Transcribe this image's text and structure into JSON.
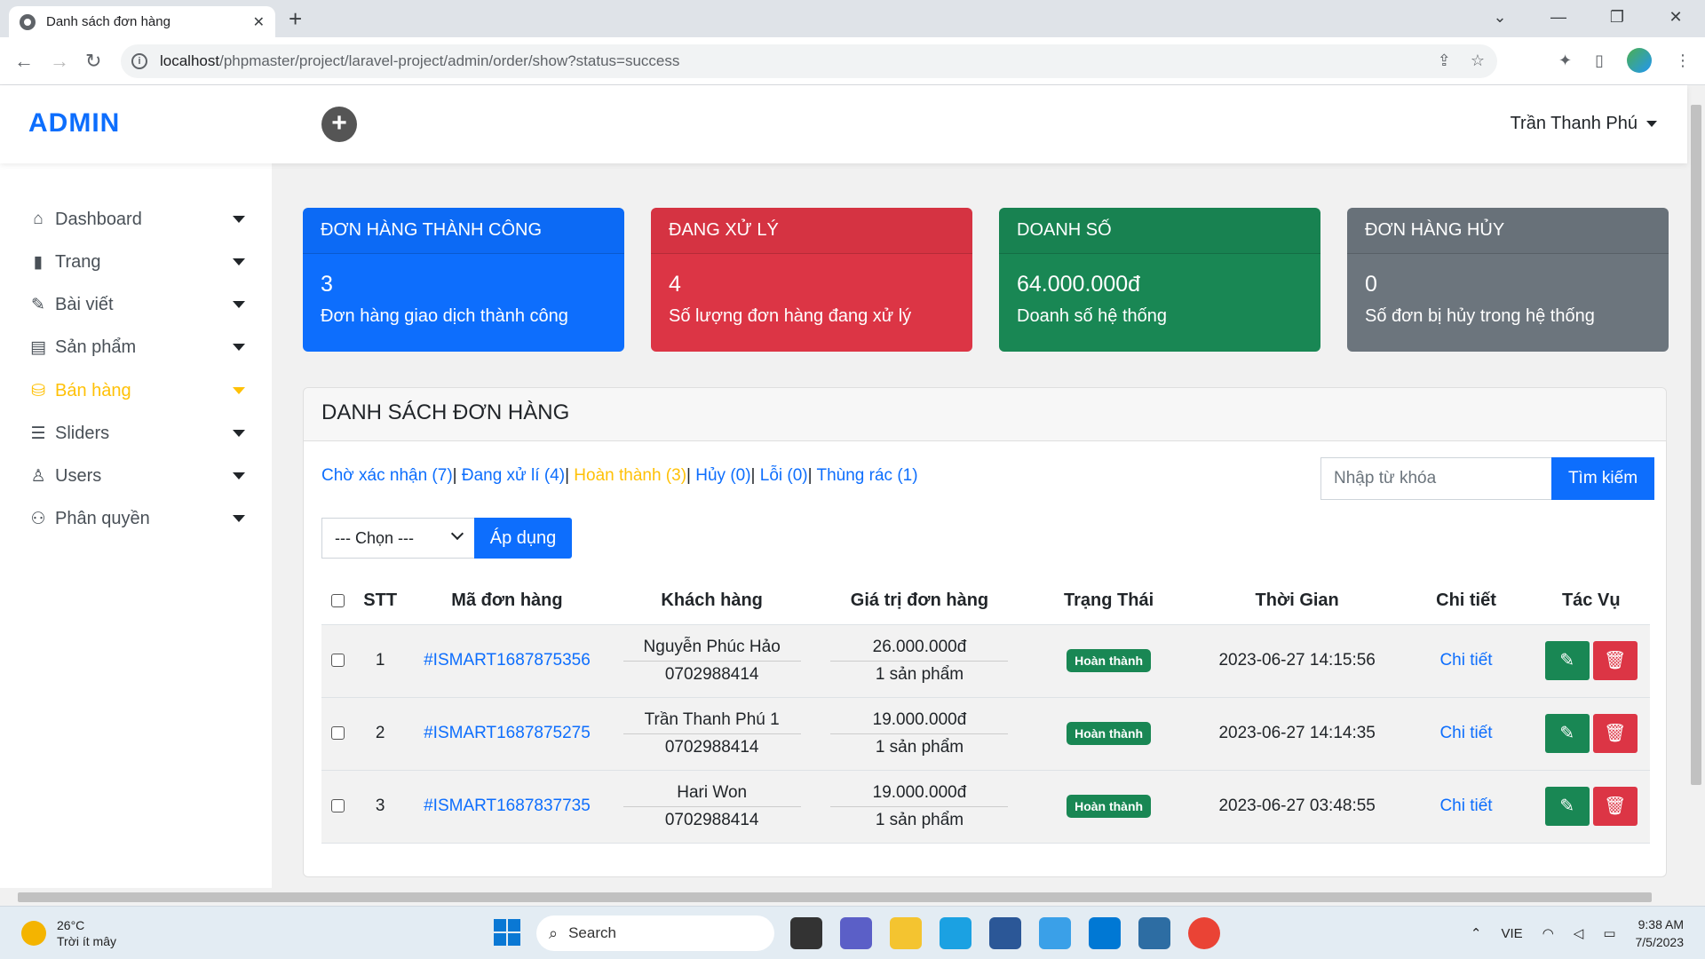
{
  "browser": {
    "tab_title": "Danh sách đơn hàng",
    "url_host": "localhost",
    "url_path": "/phpmaster/project/laravel-project/admin/order/show?status=success"
  },
  "header": {
    "brand": "ADMIN",
    "user_name": "Trần Thanh Phú"
  },
  "sidebar": {
    "items": [
      {
        "label": "Dashboard",
        "icon": "home-icon"
      },
      {
        "label": "Trang",
        "icon": "file-icon"
      },
      {
        "label": "Bài viết",
        "icon": "edit-icon"
      },
      {
        "label": "Sản phẩm",
        "icon": "store-icon"
      },
      {
        "label": "Bán hàng",
        "icon": "basket-icon",
        "active": true
      },
      {
        "label": "Sliders",
        "icon": "sliders-icon"
      },
      {
        "label": "Users",
        "icon": "user-icon"
      },
      {
        "label": "Phân quyền",
        "icon": "users-icon"
      }
    ]
  },
  "stats": [
    {
      "title": "ĐƠN HÀNG THÀNH CÔNG",
      "value": "3",
      "desc": "Đơn hàng giao dịch thành công",
      "color": "#0d6efd"
    },
    {
      "title": "ĐANG XỬ LÝ",
      "value": "4",
      "desc": "Số lượng đơn hàng đang xử lý",
      "color": "#dc3545"
    },
    {
      "title": "DOANH SỐ",
      "value": "64.000.000đ",
      "desc": "Doanh số hệ thống",
      "color": "#198754"
    },
    {
      "title": "ĐƠN HÀNG HỦY",
      "value": "0",
      "desc": "Số đơn bị hủy trong hệ thống",
      "color": "#6c757d"
    }
  ],
  "panel": {
    "title": "DANH SÁCH ĐƠN HÀNG",
    "filters": [
      {
        "label": "Chờ xác nhận (7)",
        "active": false
      },
      {
        "label": "Đang xử lí (4)",
        "active": false
      },
      {
        "label": "Hoàn thành (3)",
        "active": true
      },
      {
        "label": "Hủy (0)",
        "active": false
      },
      {
        "label": "Lỗi (0)",
        "active": false
      },
      {
        "label": "Thùng rác (1)",
        "active": false
      }
    ],
    "search_placeholder": "Nhập từ khóa",
    "search_button": "Tìm kiếm",
    "select_value": "--- Chọn ---",
    "apply_button": "Áp dụng"
  },
  "table": {
    "headers": [
      "STT",
      "Mã đơn hàng",
      "Khách hàng",
      "Giá trị đơn hàng",
      "Trạng Thái",
      "Thời Gian",
      "Chi tiết",
      "Tác Vụ"
    ],
    "rows": [
      {
        "stt": "1",
        "code": "#ISMART1687875356",
        "customer": "Nguyễn Phúc Hảo",
        "phone": "0702988414",
        "total": "26.000.000đ",
        "qty": "1 sản phẩm",
        "status": "Hoàn thành",
        "time": "2023-06-27 14:15:56",
        "detail": "Chi tiết"
      },
      {
        "stt": "2",
        "code": "#ISMART1687875275",
        "customer": "Trần Thanh Phú 1",
        "phone": "0702988414",
        "total": "19.000.000đ",
        "qty": "1 sản phẩm",
        "status": "Hoàn thành",
        "time": "2023-06-27 14:14:35",
        "detail": "Chi tiết"
      },
      {
        "stt": "3",
        "code": "#ISMART1687837735",
        "customer": "Hari Won",
        "phone": "0702988414",
        "total": "19.000.000đ",
        "qty": "1 sản phẩm",
        "status": "Hoàn thành",
        "time": "2023-06-27 03:48:55",
        "detail": "Chi tiết"
      }
    ]
  },
  "taskbar": {
    "temperature": "26°C",
    "weather": "Trời ít mây",
    "search": "Search",
    "language": "VIE",
    "time": "9:38 AM",
    "date": "7/5/2023"
  }
}
